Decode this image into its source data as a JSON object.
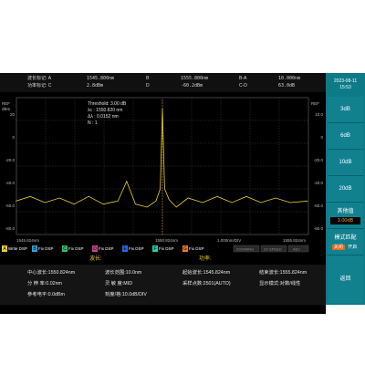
{
  "header": {
    "row1": {
      "left_label": "波长标记: A",
      "a_value": "1545.800nm",
      "b_label": "B",
      "b_value": "1555.800nm",
      "ba_label": "B-A",
      "ba_value": "10.000nm"
    },
    "row2": {
      "left_label": "功率标记: C",
      "c_value": "2.8dBm",
      "d_label": "D",
      "d_value": "-60.2dBm",
      "cd_label": "C-D",
      "cd_value": "63.0dB"
    }
  },
  "datetime": {
    "date": "2023-08-11",
    "time": "15:53"
  },
  "threshold_box": {
    "line1": "Threshold: 3.00 dB",
    "line2": "λc   : 1550.820 nm",
    "line3": "Δλ : 0.0152 nm",
    "line4": "N    : 1"
  },
  "plot": {
    "ref_left": "REF",
    "ref_right": "REF",
    "unit_left": "dBm",
    "y_left_ticks": [
      "20",
      "0",
      "-20.0",
      "-40.0",
      "-60.0",
      "-80.0"
    ],
    "y_right_ticks": [
      "10.0",
      "0",
      "-20.0",
      "-40.0",
      "-60.0",
      "-80.0"
    ],
    "x_left": "1545.824nm",
    "x_center": "1550.824nm",
    "x_right": "1555.824nm",
    "div": "1.000nm/DIV",
    "status_badges": [
      "ZOOMING",
      "2X SPEED",
      "ADJ"
    ],
    "axis_left_bottom": "0.0",
    "axis_left_top": "-20.0"
  },
  "traces": [
    {
      "letter": "A",
      "label": "Write DSP",
      "color": "#e8d22a"
    },
    {
      "letter": "B",
      "label": "Fix DSP",
      "color": "#2aa3e8"
    },
    {
      "letter": "C",
      "label": "Fix DSP",
      "color": "#30c060"
    },
    {
      "letter": "D",
      "label": "Fix DSP",
      "color": "#d04090"
    },
    {
      "letter": "E",
      "label": "Fix DSP",
      "color": "#2a6ae8"
    },
    {
      "letter": "F",
      "label": "Fix DSP",
      "color": "#30c8a8"
    },
    {
      "letter": "G",
      "label": "Fix DSP",
      "color": "#e87a2a"
    }
  ],
  "section_labels": {
    "wavelength": "波长:",
    "power": "功率:"
  },
  "info": {
    "center_wl": "中心波长:1550.824nm",
    "span": "波长范围:10.0nm",
    "start_wl": "起始波长:1545.824nm",
    "stop_wl": "结束波长:1555.824nm",
    "resolution": "分 辨 率:0.02nm",
    "sensitivity": "灵 敏 度:MID",
    "points": "采样点数:2501(AUTO)",
    "display_mode": "显示模式:对数/线性",
    "ref_level": "参考电平:0.0dBm",
    "scale": "刻度/格:10.0dB/DIV"
  },
  "right_panel": {
    "btn_3db": "3dB",
    "btn_6db": "6dB",
    "btn_10db": "10dB",
    "btn_20db": "20dB",
    "other_label": "其他值",
    "other_value": "3.00dB",
    "mode_label": "模式匹配",
    "mode_off": "关闭",
    "mode_on": "开启",
    "back": "返回"
  },
  "chart_data": {
    "type": "line",
    "xlim": [
      1545.824,
      1555.824
    ],
    "ylim": [
      -80,
      10
    ],
    "x": [
      1545.8,
      1546.3,
      1546.8,
      1547.3,
      1547.8,
      1548.3,
      1548.8,
      1549.3,
      1549.6,
      1549.9,
      1550.3,
      1550.6,
      1550.75,
      1550.824,
      1550.9,
      1551.05,
      1551.3,
      1551.7,
      1552.2,
      1552.7,
      1553.2,
      1553.7,
      1554.2,
      1554.7,
      1555.2,
      1555.8
    ],
    "y": [
      -58,
      -55,
      -59,
      -56,
      -60,
      -55,
      -60,
      -58,
      -45,
      -60,
      -62,
      -58,
      -50,
      3,
      -50,
      -57,
      -62,
      -56,
      -59,
      -55,
      -59,
      -55,
      -59,
      -56,
      -59,
      -58
    ]
  }
}
